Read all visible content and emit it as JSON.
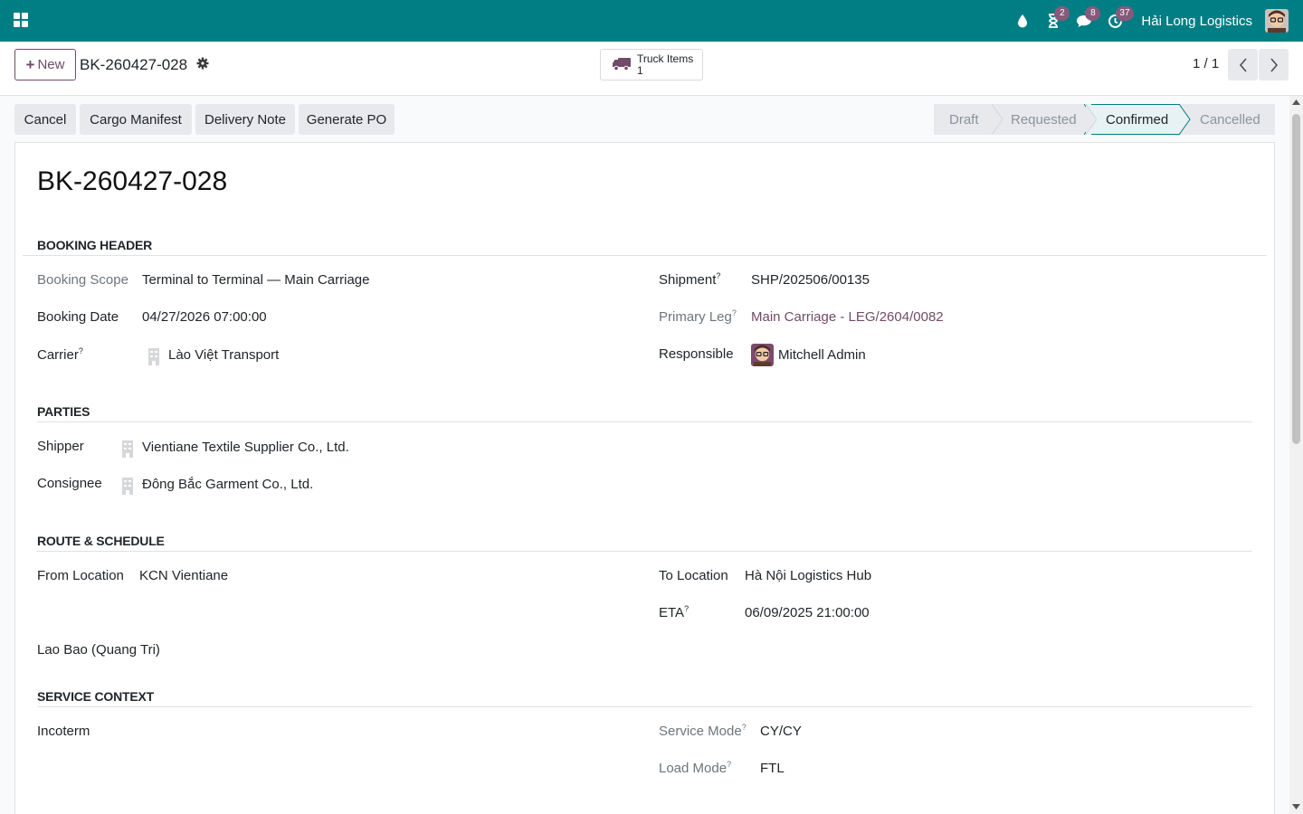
{
  "navbar": {
    "apps_icon": "apps-grid-icon",
    "icons": [
      {
        "name": "water-drop-icon",
        "badge": ""
      },
      {
        "name": "hourglass-icon",
        "badge": "2"
      },
      {
        "name": "chat-icon",
        "badge": "8"
      },
      {
        "name": "clock-activity-icon",
        "badge": "37"
      }
    ],
    "company": "Hải Long Logistics",
    "bg_color": "#017e84"
  },
  "control_panel": {
    "new_label": "New",
    "breadcrumb": "BK-260427-028",
    "smart_button": {
      "label": "Truck Items",
      "count": "1",
      "icon": "truck-icon"
    },
    "pager": "1 / 1"
  },
  "actions": [
    "Cancel",
    "Cargo Manifest",
    "Delivery Note",
    "Generate PO"
  ],
  "statusbar": {
    "stages": [
      "Draft",
      "Requested",
      "Confirmed",
      "Cancelled"
    ],
    "active": "Confirmed"
  },
  "form": {
    "title": "BK-260427-028",
    "booking_header": {
      "section": "BOOKING HEADER",
      "booking_scope_label": "Booking Scope",
      "booking_scope": "Terminal to Terminal — Main Carriage",
      "booking_date_label": "Booking Date",
      "booking_date": "04/27/2026 07:00:00",
      "carrier_label": "Carrier",
      "carrier": "Lào Việt Transport",
      "shipment_label": "Shipment",
      "shipment": "SHP/202506/00135",
      "primary_leg_label": "Primary Leg",
      "primary_leg": "Main Carriage - LEG/2604/0082",
      "responsible_label": "Responsible",
      "responsible": "Mitchell Admin"
    },
    "parties": {
      "section": "PARTIES",
      "shipper_label": "Shipper",
      "shipper": "Vientiane Textile Supplier Co., Ltd.",
      "consignee_label": "Consignee",
      "consignee": "Đông Bắc Garment Co., Ltd."
    },
    "route": {
      "section": "ROUTE & SCHEDULE",
      "from_label": "From Location",
      "from": "KCN Vientiane",
      "to_label": "To Location",
      "to": "Hà Nội Logistics Hub",
      "eta_label": "ETA",
      "eta": "06/09/2025 21:00:00",
      "via": "Lao Bao (Quang Tri)"
    },
    "service": {
      "section": "SERVICE CONTEXT",
      "incoterm_label": "Incoterm",
      "service_mode_label": "Service Mode",
      "service_mode": "CY/CY",
      "load_mode_label": "Load Mode",
      "load_mode": "FTL"
    },
    "help_marker": "?"
  }
}
